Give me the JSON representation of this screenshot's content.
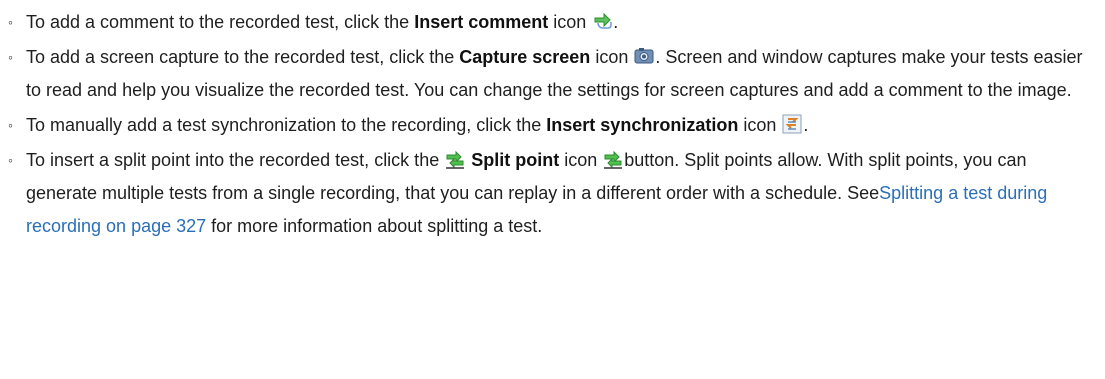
{
  "items": [
    {
      "pre": "To add a comment to the recorded test, click the ",
      "bold": "Insert comment",
      "post": " icon ",
      "tail": "."
    },
    {
      "pre": "To add a screen capture to the recorded test, click the ",
      "bold": "Capture screen",
      "post": " icon ",
      "tail": ". Screen and window captures make your tests easier to read and help you visualize the recorded test. You can change the settings for screen captures and add a comment to the image."
    },
    {
      "pre": "To manually add a test synchronization to the recording, click the ",
      "bold": "Insert synchronization",
      "post": " icon ",
      "tail": "."
    },
    {
      "pre": "To insert a split point into the recorded test, click the ",
      "bold": "Split point",
      "mid": " icon ",
      "after_icon": "button. Split points allow. With split points, you can generate multiple tests from a single recording, that you can replay in a different order with a schedule. See",
      "link": "Splitting a test during recording on page 327",
      "tail": " for more information about splitting a test."
    }
  ],
  "bullet_glyph": "◦",
  "icons": [
    "insert-comment-icon",
    "capture-screen-icon",
    "insert-synchronization-icon",
    "split-point-icon"
  ],
  "colors": {
    "link": "#2a6fb7",
    "text": "#1f1f1f",
    "icon_green": "#3fae3f"
  }
}
